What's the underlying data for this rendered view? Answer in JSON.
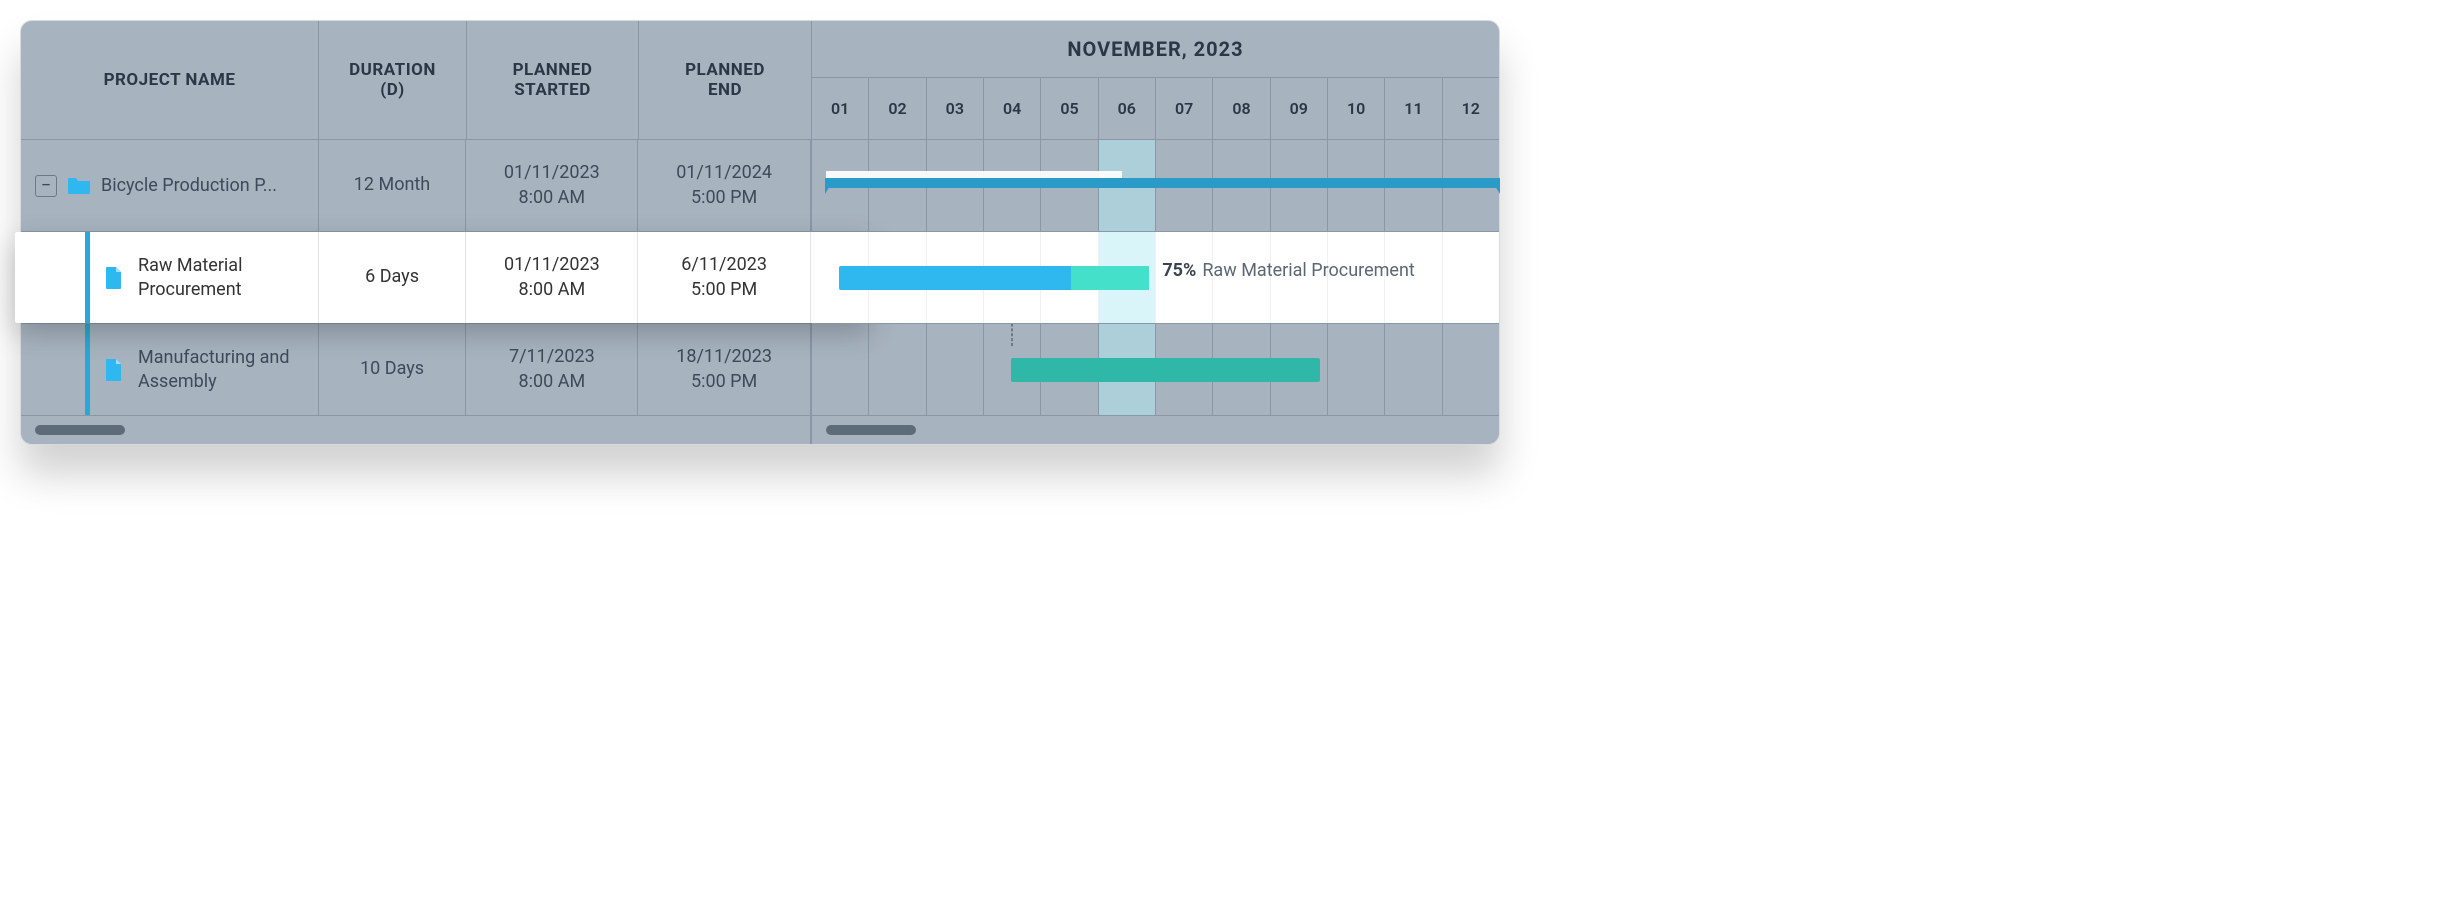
{
  "columns": {
    "name": "PROJECT NAME",
    "duration_line1": "DURATION",
    "duration_line2": "(D)",
    "planned_start_line1": "PLANNED",
    "planned_start_line2": "STARTED",
    "planned_end_line1": "PLANNED",
    "planned_end_line2": "END"
  },
  "timeline": {
    "month_label": "NOVEMBER, 2023",
    "days": [
      "01",
      "02",
      "03",
      "04",
      "05",
      "06",
      "07",
      "08",
      "09",
      "10",
      "11",
      "12"
    ],
    "today_index": 5
  },
  "rows": [
    {
      "type": "summary",
      "name": "Bicycle Production P...",
      "duration": "12 Month",
      "start_line1": "01/11/2023",
      "start_line2": "8:00 AM",
      "end_line1": "01/11/2024",
      "end_line2": "5:00 PM",
      "bar": {
        "left_pct": 2,
        "width_pct": 98,
        "progress_pct": 44
      }
    },
    {
      "type": "task",
      "highlighted": true,
      "name": "Raw Material Procurement",
      "duration": "6 Days",
      "start_line1": "01/11/2023",
      "start_line2": "8:00 AM",
      "end_line1": "6/11/2023",
      "end_line2": "5:00 PM",
      "bar": {
        "left_pct": 4,
        "width_pct": 45,
        "progress_pct": 75,
        "color": "blue"
      },
      "label_pct": "75%",
      "label_text": "Raw Material Procurement"
    },
    {
      "type": "task",
      "name": "Manufacturing and Assembly",
      "duration": "10 Days",
      "start_line1": "7/11/2023",
      "start_line2": "8:00 AM",
      "end_line1": "18/11/2023",
      "end_line2": "5:00 PM",
      "bar": {
        "left_pct": 29,
        "width_pct": 45,
        "color": "teal"
      }
    }
  ],
  "icons": {
    "collapse": "−"
  }
}
